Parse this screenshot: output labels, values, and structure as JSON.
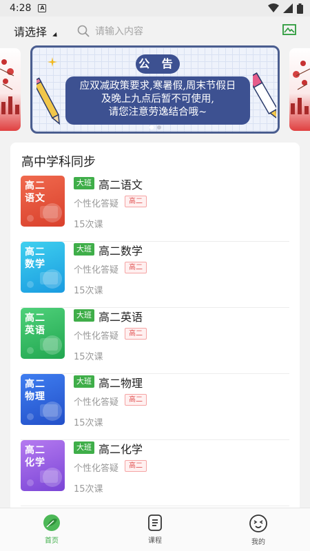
{
  "status": {
    "time": "4:28",
    "notif_icon": "A"
  },
  "header": {
    "select_label": "请选择",
    "search_placeholder": "请输入内容"
  },
  "banner": {
    "badge": "公 告",
    "line1": "应双减政策要求,寒暑假,周末节假日",
    "line2": "及晚上九点后暂不可使用,",
    "line3": "请您注意劳逸结合哦~"
  },
  "section": {
    "title": "高中学科同步"
  },
  "courses": [
    {
      "cover_l1": "高二",
      "cover_l2": "语文",
      "badge": "大班",
      "name": "高二语文",
      "desc": "个性化答疑",
      "grade": "高二",
      "lessons": "15次课",
      "color1": "#f06a4e",
      "color2": "#d9402c"
    },
    {
      "cover_l1": "高二",
      "cover_l2": "数学",
      "badge": "大班",
      "name": "高二数学",
      "desc": "个性化答疑",
      "grade": "高二",
      "lessons": "15次课",
      "color1": "#3fd0ef",
      "color2": "#1a9be0"
    },
    {
      "cover_l1": "高二",
      "cover_l2": "英语",
      "badge": "大班",
      "name": "高二英语",
      "desc": "个性化答疑",
      "grade": "高二",
      "lessons": "15次课",
      "color1": "#4fd17a",
      "color2": "#21a650"
    },
    {
      "cover_l1": "高二",
      "cover_l2": "物理",
      "badge": "大班",
      "name": "高二物理",
      "desc": "个性化答疑",
      "grade": "高二",
      "lessons": "15次课",
      "color1": "#3f7ef0",
      "color2": "#2350c9"
    },
    {
      "cover_l1": "高二",
      "cover_l2": "化学",
      "badge": "大班",
      "name": "高二化学",
      "desc": "个性化答疑",
      "grade": "高二",
      "lessons": "15次课",
      "color1": "#b57af0",
      "color2": "#7a45d6"
    }
  ],
  "nav": {
    "home": "首页",
    "courses": "课程",
    "mine": "我的"
  },
  "colors": {
    "accent": "#3fae49",
    "banner_blue": "#3d5191"
  }
}
